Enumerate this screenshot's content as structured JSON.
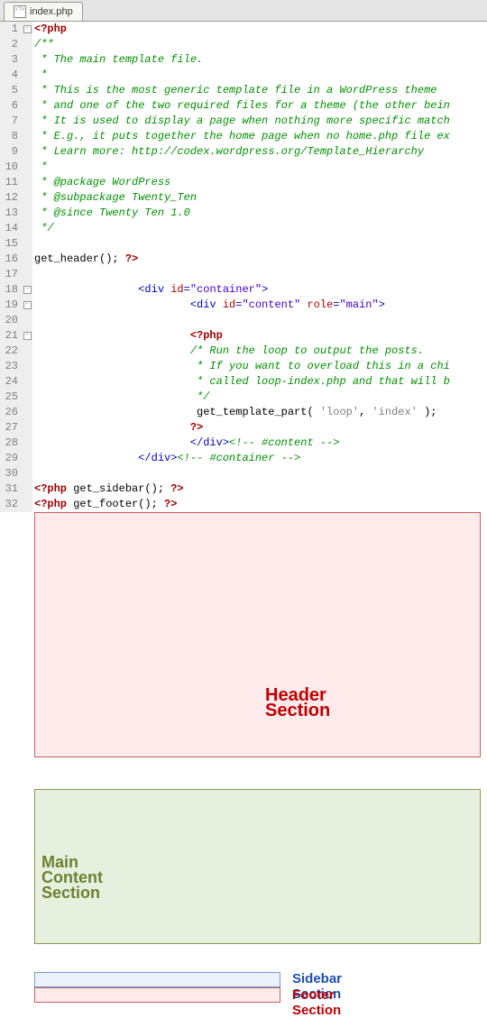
{
  "tab": {
    "title": "index.php"
  },
  "lines": {
    "l1": "<?php",
    "l2": "/**",
    "l3": " * The main template file.",
    "l4": " *",
    "l5": " * This is the most generic template file in a WordPress theme",
    "l6": " * and one of the two required files for a theme (the other bein",
    "l7": " * It is used to display a page when nothing more specific match",
    "l8": " * E.g., it puts together the home page when no home.php file ex",
    "l9": " * Learn more: http://codex.wordpress.org/Template_Hierarchy",
    "l10": " *",
    "l11": " * @package WordPress",
    "l12": " * @subpackage Twenty_Ten",
    "l13": " * @since Twenty Ten 1.0",
    "l14": " */",
    "l16a": "get_header",
    "l16b": "(); ",
    "l16c": "?>",
    "l18_pre": "                ",
    "l18_tag": "div",
    "l18_attr": "id",
    "l18_val": "\"container\"",
    "l19_pre": "                        ",
    "l19_tag": "div",
    "l19_a1": "id",
    "l19_v1": "\"content\"",
    "l19_a2": "role",
    "l19_v2": "\"main\"",
    "l21_pre": "                        ",
    "l21_kw": "<?php",
    "l22": "                        /* Run the loop to output the posts.",
    "l23": "                         * If you want to overload this in a chi",
    "l24": "                         * called loop-index.php and that will b",
    "l25": "                         */",
    "l26_pre": "                         ",
    "l26_fn": "get_template_part( ",
    "l26_s1": "'loop'",
    "l26_s2": "'index'",
    "l26_tail": " );",
    "l27_pre": "                        ",
    "l27_kw": "?>",
    "l28_pre": "                        ",
    "l28_close": "</div>",
    "l28_cm": "<!-- #content -->",
    "l29_pre": "                ",
    "l29_close": "</div>",
    "l29_cm": "<!-- #container -->",
    "l31_a": "<?php",
    "l31_b": " get_sidebar(); ",
    "l31_c": "?>",
    "l32_a": "<?php",
    "l32_b": " get_footer(); ",
    "l32_c": "?>"
  },
  "labels": {
    "header": "Header Section",
    "main": "Main Content Section",
    "sidebar": "Sidebar Section",
    "footer": "Footer Section"
  }
}
